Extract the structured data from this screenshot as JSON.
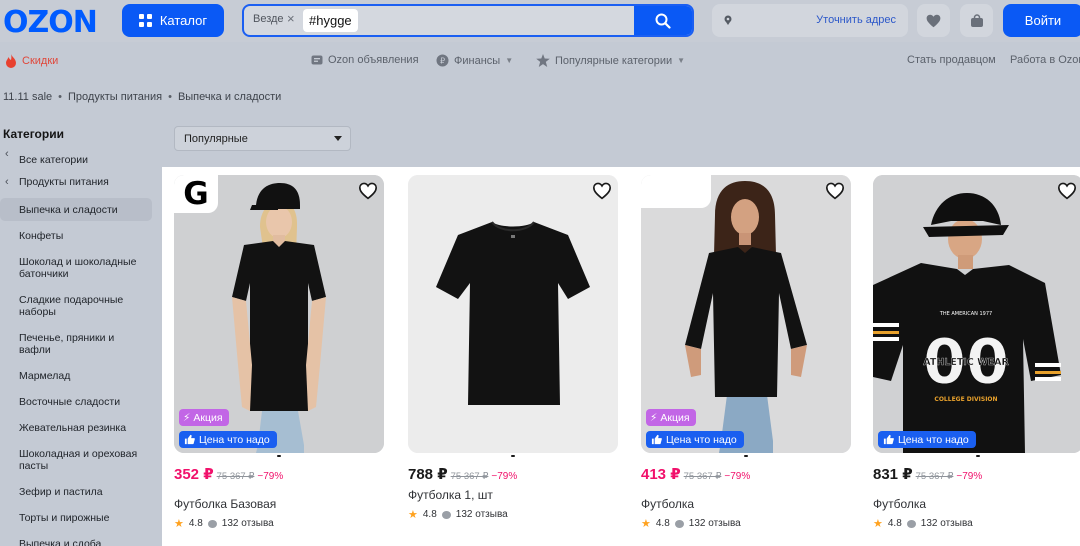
{
  "header": {
    "logo": "OZON",
    "catalog_label": "Каталог",
    "search_scope": "Везде",
    "search_clear": "×",
    "search_query": "#hygge",
    "address_link": "Уточнить адрес",
    "login_label": "Войти",
    "accent_color": "#005bff"
  },
  "nav": {
    "sale": "Скидки",
    "ads": "Ozon объявления",
    "finance": "Финансы",
    "popular": "Популярные категории",
    "become_seller": "Стать продавцом",
    "work": "Работа в Ozon"
  },
  "breadcrumb": [
    "11.11 sale",
    "Продукты питания",
    "Выпечка и сладости"
  ],
  "categories": {
    "title": "Категории",
    "items": [
      {
        "label": "Все категории",
        "back": true
      },
      {
        "label": "Продукты питания",
        "back": true
      },
      {
        "label": "Выпечка и сладости",
        "active": true
      },
      {
        "label": "Конфеты"
      },
      {
        "label": "Шоколад и шоколадные батончики"
      },
      {
        "label": "Сладкие подарочные наборы"
      },
      {
        "label": "Печенье, пряники и вафли"
      },
      {
        "label": "Мармелад"
      },
      {
        "label": "Восточные сладости"
      },
      {
        "label": "Жевательная резинка"
      },
      {
        "label": "Шоколадная и ореховая пасты"
      },
      {
        "label": "Зефир и пастила"
      },
      {
        "label": "Торты и пирожные"
      },
      {
        "label": "Выпечка и сдоба"
      }
    ]
  },
  "sort": {
    "selected": "Популярные"
  },
  "products": [
    {
      "price": "352 ₽",
      "old_price": "75 367 ₽",
      "discount": "−79%",
      "price_red": true,
      "title": "Футболка Базовая",
      "rating": "4.8",
      "reviews": "132 отзыва",
      "badge_akcia": "Акция",
      "badge_price": "Цена что надо",
      "brand_logo": "G"
    },
    {
      "price": "788 ₽",
      "old_price": "75 367 ₽",
      "discount": "−79%",
      "price_red": false,
      "title": "Футболка 1, шт",
      "rating": "4.8",
      "reviews": "132 отзыва"
    },
    {
      "price": "413 ₽",
      "old_price": "75 367 ₽",
      "discount": "−79%",
      "price_red": true,
      "title": "Футболка",
      "rating": "4.8",
      "reviews": "132 отзыва",
      "badge_akcia": "Акция",
      "badge_price": "Цена что надо"
    },
    {
      "price": "831 ₽",
      "old_price": "75 367 ₽",
      "discount": "−79%",
      "price_red": false,
      "title": "Футболка",
      "rating": "4.8",
      "reviews": "132 отзыва",
      "badge_price": "Цена что надо",
      "shirt_print_top": "THE AMERICAN 1977",
      "shirt_number": "00",
      "shirt_print_mid": "ATHLETIC WEAR",
      "shirt_print_bottom": "COLLEGE DIVISION"
    }
  ]
}
